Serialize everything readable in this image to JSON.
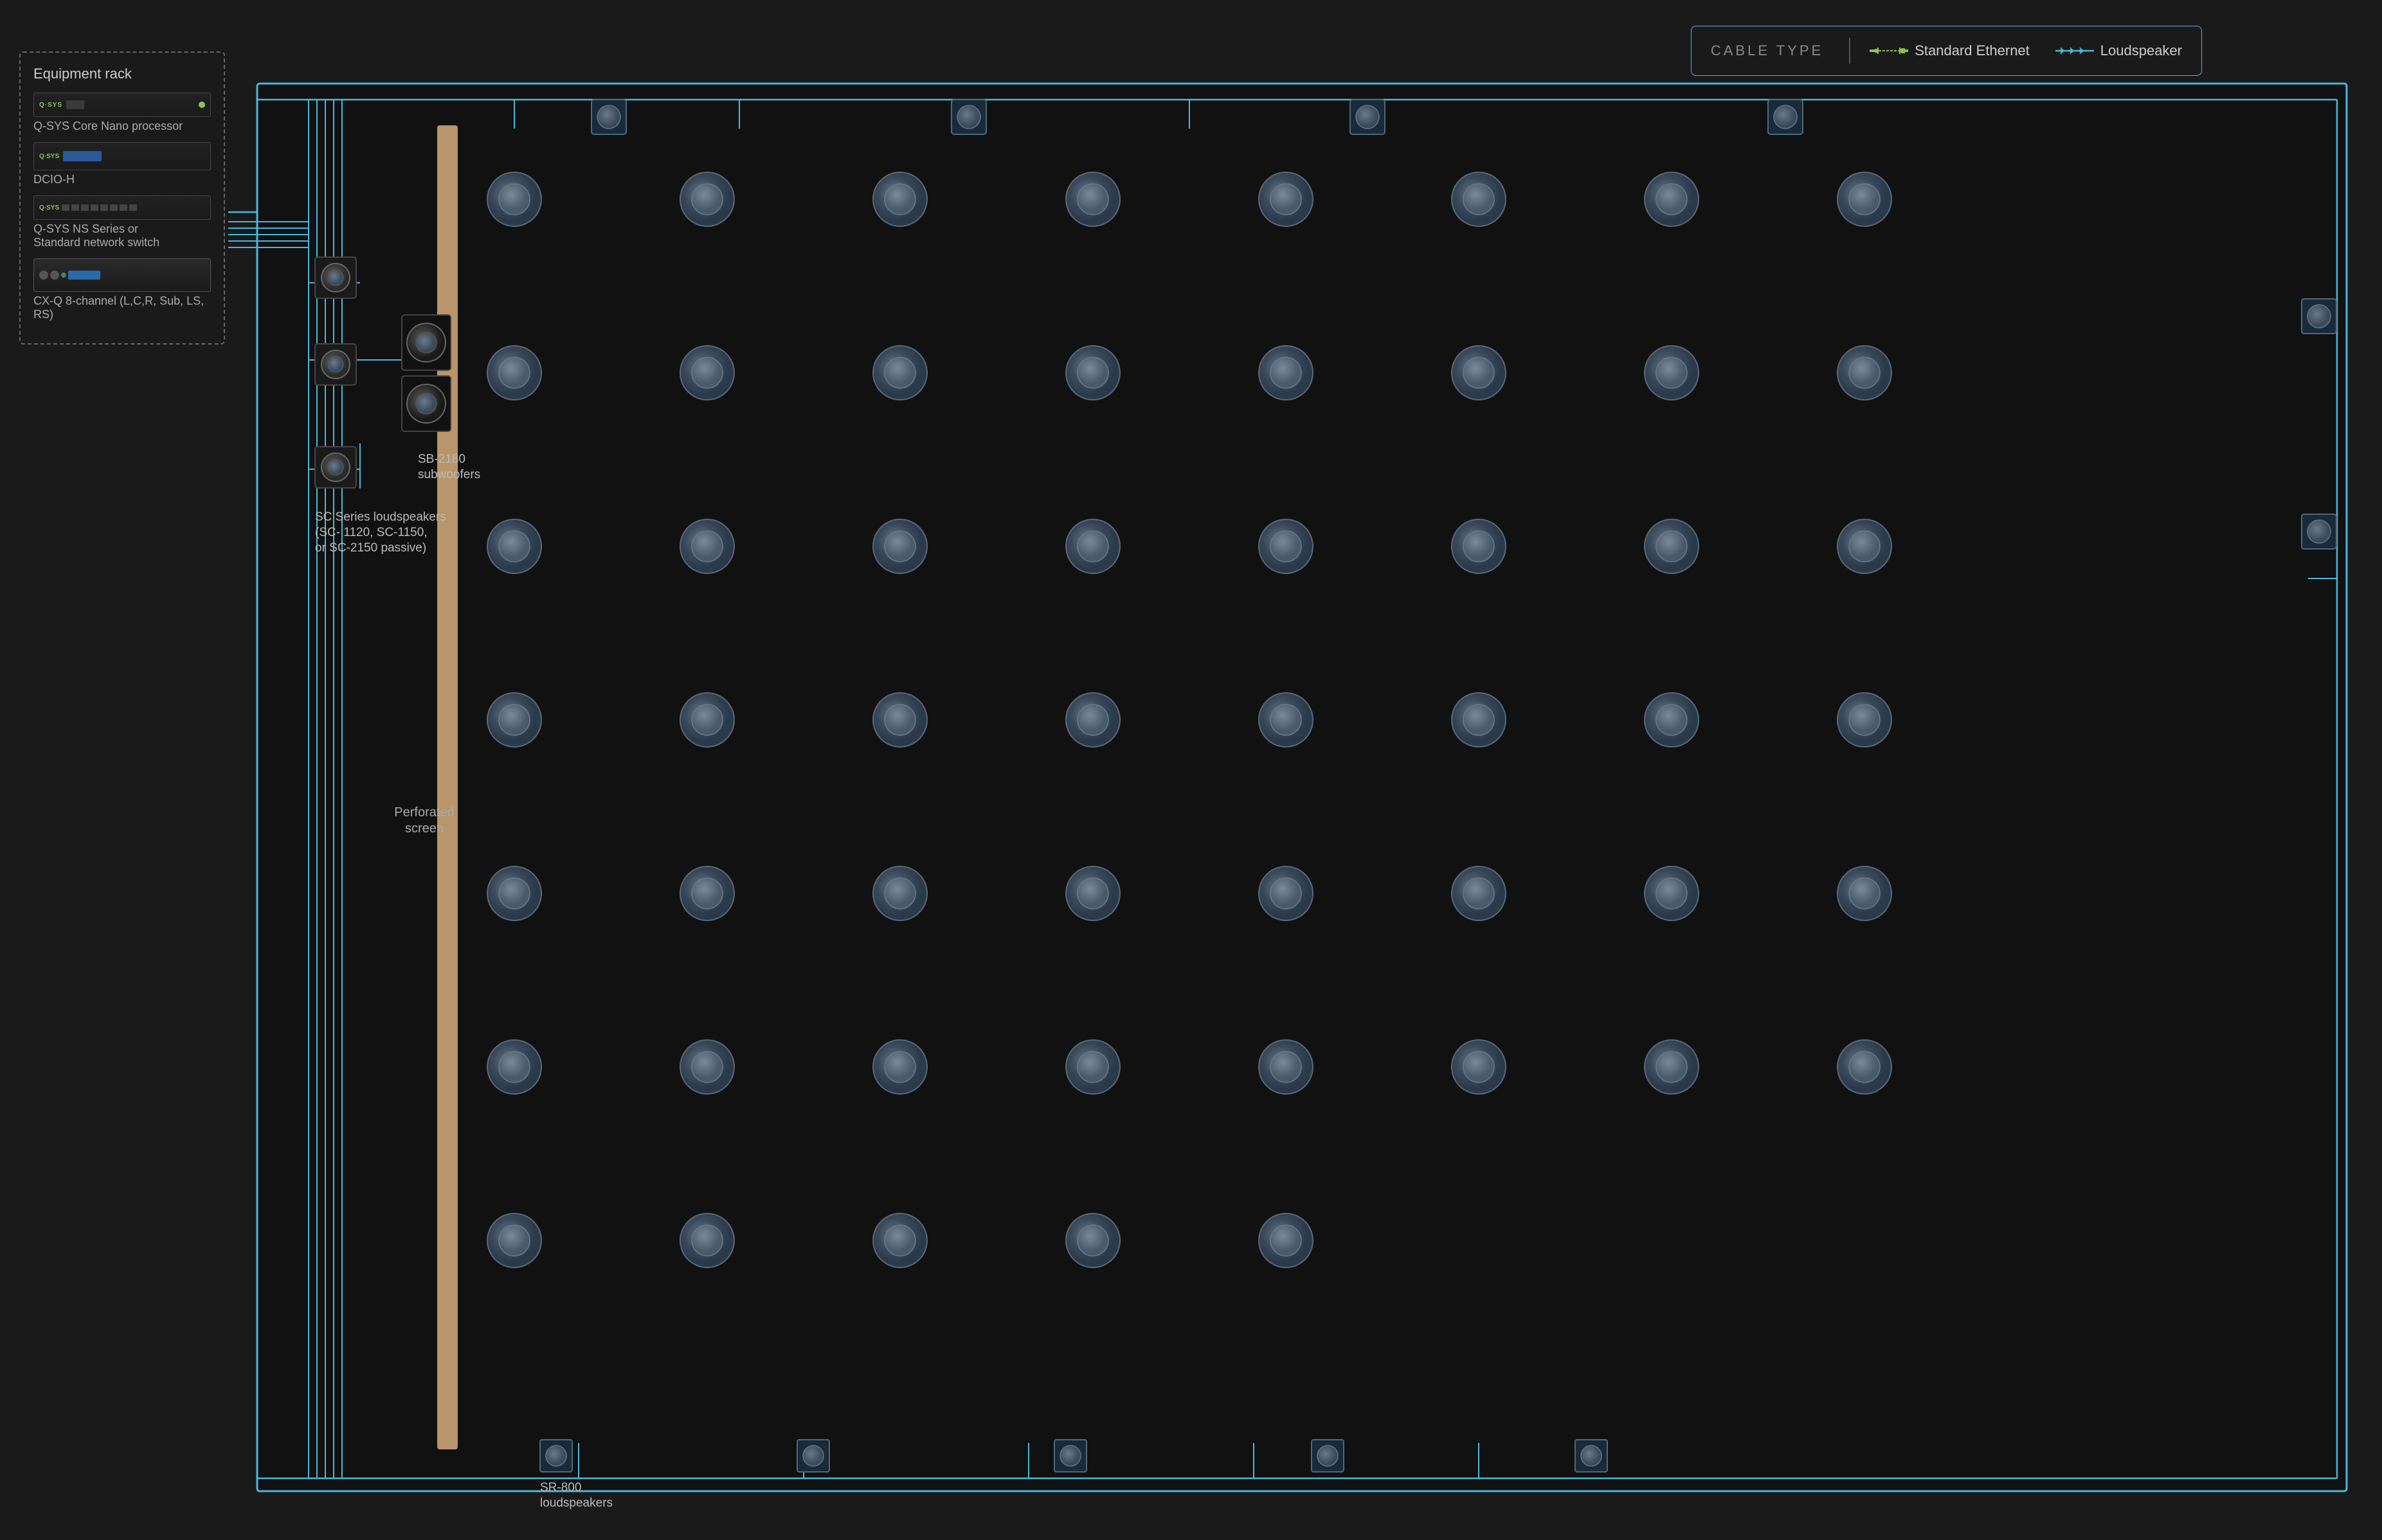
{
  "legend": {
    "title": "CABLE TYPE",
    "ethernet_label": "Standard Ethernet",
    "loudspeaker_label": "Loudspeaker"
  },
  "rack": {
    "title": "Equipment rack",
    "devices": [
      {
        "id": "nano",
        "brand": "Q-SYS",
        "label": "Q-SYS Core Nano processor"
      },
      {
        "id": "dcio",
        "brand": "Q-SYS",
        "label": "DCIO-H"
      },
      {
        "id": "ns",
        "brand": "Q-SYS",
        "label": "Q-SYS NS Series or\nStandard network switch"
      },
      {
        "id": "cxq",
        "brand": "",
        "label": "CX-Q 8-channel (L,C,R, Sub, LS, RS)"
      }
    ]
  },
  "diagram": {
    "screen_label": "Perforated\nscreen",
    "subwoofer_label": "SB-2180\nsubwoofers",
    "sc_speaker_label": "SC Series loudspeakers\n(SC- 1120, SC-1150,\nor SC-2150 passive)",
    "sr_speaker_label": "SR-800\nloudspeakers"
  },
  "colors": {
    "ethernet_line": "#4ab8d8",
    "speaker_line": "#4ab8d8",
    "accent_green": "#90c44b",
    "border_blue": "#4ab8d8"
  }
}
